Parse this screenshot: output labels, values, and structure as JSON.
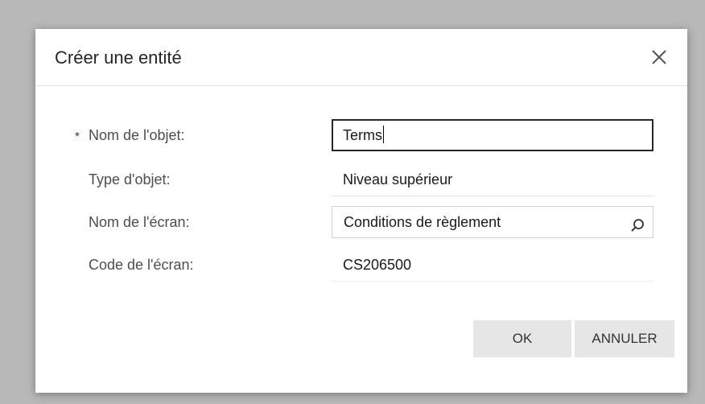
{
  "dialog": {
    "title": "Créer une entité",
    "close_icon": "close-icon"
  },
  "form": {
    "object_name": {
      "required_marker": "*",
      "label": "Nom de l'objet:",
      "value": "Terms"
    },
    "object_type": {
      "label": "Type d'objet:",
      "value": "Niveau supérieur"
    },
    "screen_name": {
      "label": "Nom de l'écran:",
      "value": "Conditions de règlement",
      "icon": "search-icon"
    },
    "screen_code": {
      "label": "Code de l'écran:",
      "value": "CS206500"
    }
  },
  "buttons": {
    "ok_label": "OK",
    "cancel_label": "ANNULER"
  }
}
